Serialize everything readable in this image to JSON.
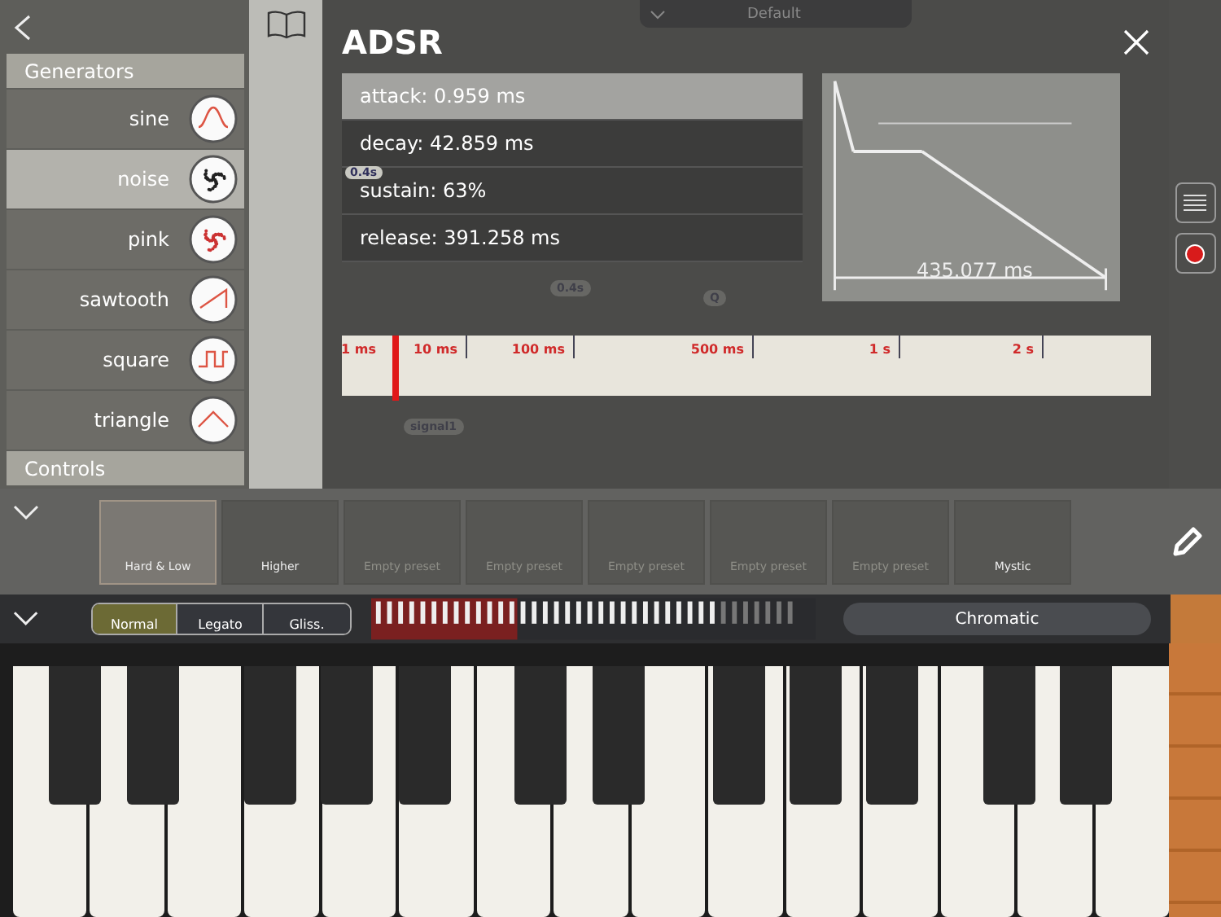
{
  "top_bar": {
    "preset_dropdown": "Default"
  },
  "canvas_nodes": [
    {
      "label": "0.4s"
    },
    {
      "label": "0.4s"
    },
    {
      "label": "signal1"
    },
    {
      "label": "Q"
    }
  ],
  "sidebar": {
    "sections": [
      {
        "title": "Generators",
        "items": [
          {
            "label": "sine",
            "kind": "sine",
            "selected": false
          },
          {
            "label": "noise",
            "kind": "noise",
            "selected": true
          },
          {
            "label": "pink",
            "kind": "pink",
            "selected": false
          },
          {
            "label": "sawtooth",
            "kind": "sawtooth",
            "selected": false
          },
          {
            "label": "square",
            "kind": "square",
            "selected": false
          },
          {
            "label": "triangle",
            "kind": "triangle",
            "selected": false
          }
        ]
      },
      {
        "title": "Controls"
      }
    ]
  },
  "adsr": {
    "title": "ADSR",
    "params": [
      {
        "label": "attack: 0.959 ms",
        "selected": true
      },
      {
        "label": "decay: 42.859 ms",
        "selected": false
      },
      {
        "label": "sustain: 63%",
        "selected": false
      },
      {
        "label": "release: 391.258 ms",
        "selected": false
      }
    ],
    "envelope_total": "435.077 ms",
    "ruler": {
      "ticks": [
        "1 ms",
        "10 ms",
        "100 ms",
        "500 ms",
        "1 s",
        "2 s"
      ],
      "marker": {
        "level": 0.066
      }
    }
  },
  "presets": [
    {
      "label": "Hard & Low",
      "kind": "preset",
      "selected": true
    },
    {
      "label": "Higher",
      "kind": "preset",
      "selected": false
    },
    {
      "label": "Empty preset",
      "kind": "empty",
      "selected": false
    },
    {
      "label": "Empty preset",
      "kind": "empty",
      "selected": false
    },
    {
      "label": "Empty preset",
      "kind": "empty",
      "selected": false
    },
    {
      "label": "Empty preset",
      "kind": "empty",
      "selected": false
    },
    {
      "label": "Empty preset",
      "kind": "empty",
      "selected": false
    },
    {
      "label": "Mystic",
      "kind": "preset",
      "selected": false
    }
  ],
  "play_modes": [
    {
      "label": "Normal",
      "selected": true
    },
    {
      "label": "Legato",
      "selected": false
    },
    {
      "label": "Gliss.",
      "selected": false
    }
  ],
  "scale": "Chromatic"
}
